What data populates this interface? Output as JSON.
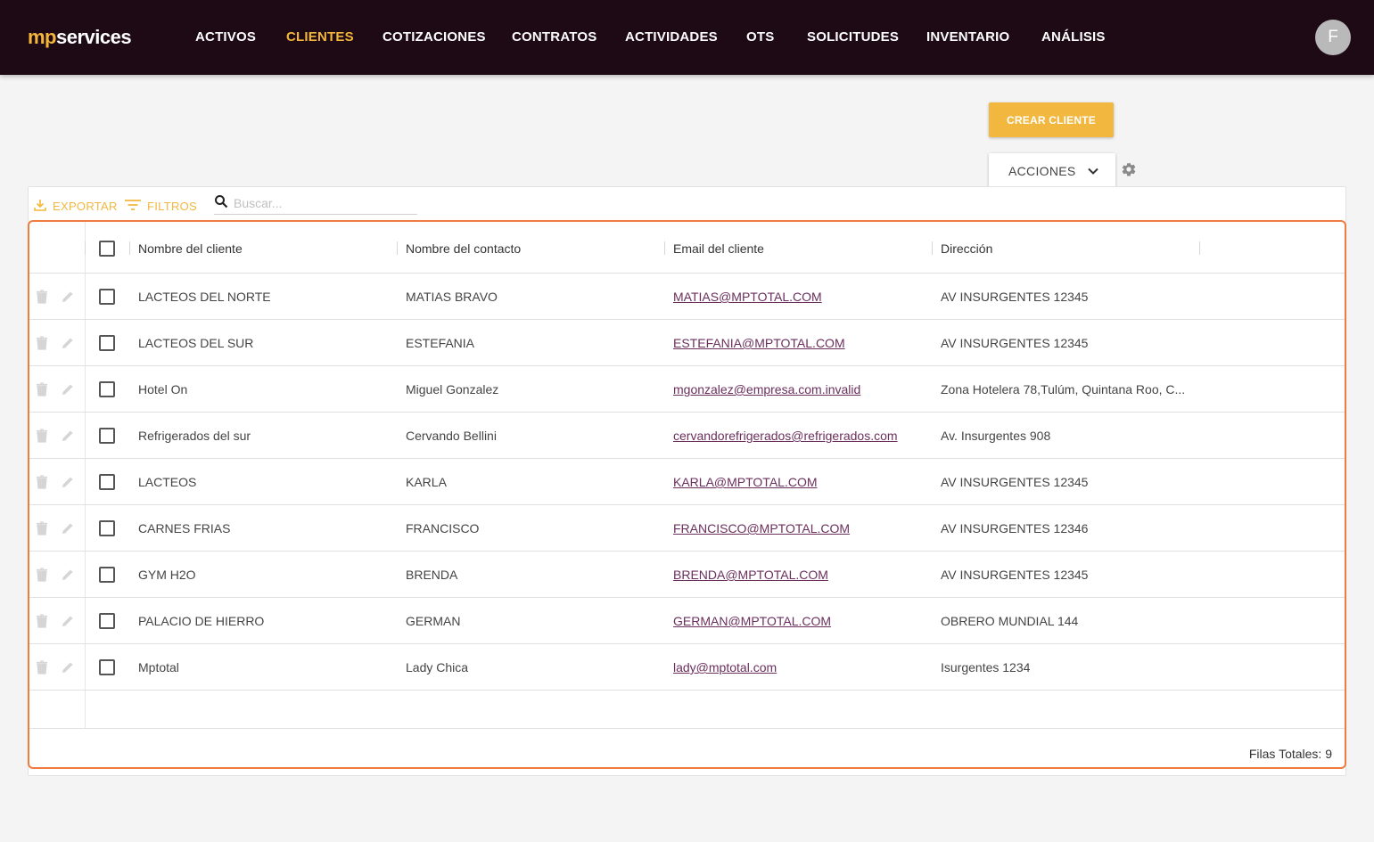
{
  "brand": {
    "prefix": "mp",
    "suffix": "services"
  },
  "nav": {
    "items": [
      {
        "label": "ACTIVOS"
      },
      {
        "label": "CLIENTES"
      },
      {
        "label": "COTIZACIONES"
      },
      {
        "label": "CONTRATOS"
      },
      {
        "label": "ACTIVIDADES"
      },
      {
        "label": "OTS"
      },
      {
        "label": "SOLICITUDES"
      },
      {
        "label": "INVENTARIO"
      },
      {
        "label": "ANÁLISIS"
      }
    ],
    "active": "CLIENTES"
  },
  "user": {
    "initial": "F"
  },
  "actions": {
    "create_label": "CREAR CLIENTE",
    "actions_label": "ACCIONES"
  },
  "toolbar": {
    "export_label": "EXPORTAR",
    "filters_label": "FILTROS",
    "search_placeholder": "Buscar..."
  },
  "table": {
    "columns": [
      "Nombre del cliente",
      "Nombre del contacto",
      "Email del cliente",
      "Dirección"
    ],
    "rows": [
      {
        "client": "LACTEOS DEL NORTE",
        "contact": "MATIAS BRAVO",
        "email": "MATIAS@MPTOTAL.COM",
        "address": "AV INSURGENTES 12345"
      },
      {
        "client": "LACTEOS DEL SUR",
        "contact": "ESTEFANIA",
        "email": "ESTEFANIA@MPTOTAL.COM",
        "address": "AV INSURGENTES 12345"
      },
      {
        "client": "Hotel On",
        "contact": "Miguel Gonzalez",
        "email": "mgonzalez@empresa.com.invalid",
        "address": "Zona Hotelera 78,Tulúm, Quintana Roo, C..."
      },
      {
        "client": "Refrigerados del sur",
        "contact": "Cervando Bellini",
        "email": "cervandorefrigerados@refrigerados.com",
        "address": "Av. Insurgentes 908"
      },
      {
        "client": "LACTEOS",
        "contact": "KARLA",
        "email": "KARLA@MPTOTAL.COM",
        "address": "AV INSURGENTES 12345"
      },
      {
        "client": "CARNES FRIAS",
        "contact": "FRANCISCO",
        "email": "FRANCISCO@MPTOTAL.COM",
        "address": "AV INSURGENTES 12346"
      },
      {
        "client": "GYM H2O",
        "contact": "BRENDA",
        "email": "BRENDA@MPTOTAL.COM",
        "address": "AV INSURGENTES 12345"
      },
      {
        "client": "PALACIO DE HIERRO",
        "contact": "GERMAN",
        "email": "GERMAN@MPTOTAL.COM",
        "address": "OBRERO MUNDIAL 144"
      },
      {
        "client": "Mptotal",
        "contact": "Lady Chica",
        "email": "lady@mptotal.com",
        "address": "Isurgentes 1234"
      }
    ],
    "total_label": "Filas Totales: 9"
  },
  "colors": {
    "brand_dark": "#1e0a14",
    "accent": "#f2b73f",
    "highlight_border": "#f07b3f",
    "link": "#6b2f5d"
  },
  "icons": {
    "row_actions": [
      "trash-icon",
      "pencil-icon"
    ],
    "toolbar": [
      "download-icon",
      "filter-icon",
      "search-icon"
    ],
    "settings": "gear-icon",
    "dropdown": "chevron-down-icon"
  }
}
